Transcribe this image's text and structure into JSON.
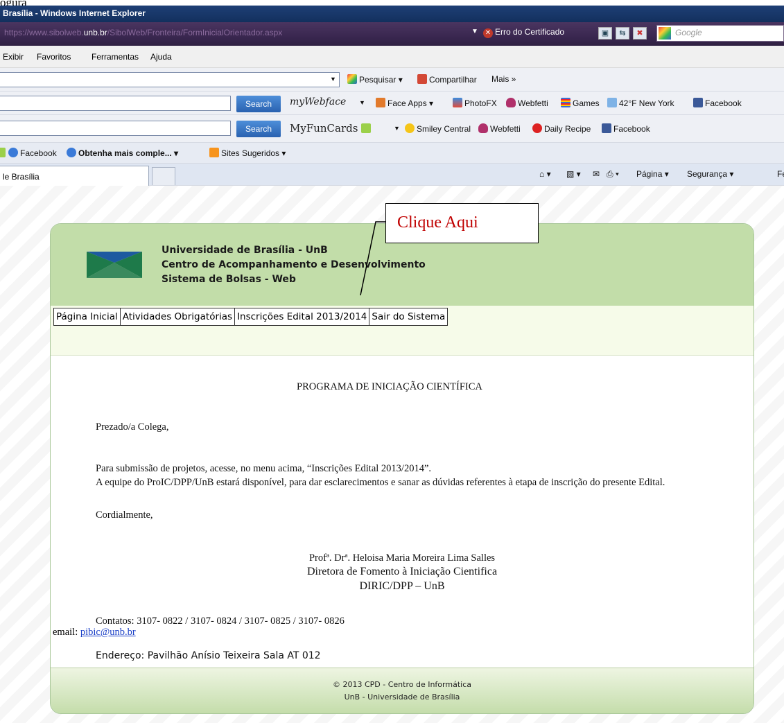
{
  "doc_text": "ogura",
  "window": {
    "title": "Brasília - Windows Internet Explorer",
    "url_prefix": "https://www.sibolweb.",
    "url_host": "unb.br",
    "url_path": "/SibolWeb/Fronteira/FormInicialOrientador.aspx",
    "cert_error": "Erro do Certificado",
    "search_placeholder": "Google"
  },
  "menu": [
    "Exibir",
    "Favoritos",
    "Ferramentas",
    "Ajuda"
  ],
  "toolbar1": {
    "search": "Pesquisar",
    "share": "Compartilhar",
    "more": "Mais »"
  },
  "toolbar2": {
    "search_button": "Search",
    "brand": "myWebface",
    "items": [
      "Face Apps",
      "PhotoFX",
      "Webfetti",
      "Games",
      "42°F New York",
      "Facebook"
    ]
  },
  "toolbar3": {
    "search_button": "Search",
    "brand": "MyFunCards",
    "items": [
      "Smiley Central",
      "Webfetti",
      "Daily Recipe",
      "Facebook"
    ]
  },
  "favorites": {
    "items": [
      "Facebook",
      "Obtenha mais comple...",
      "Sites Sugeridos"
    ]
  },
  "tabs": {
    "active": "le Brasília",
    "commands": [
      "Página",
      "Segurança",
      "Fe"
    ]
  },
  "page": {
    "header_lines": [
      "Universidade de Brasília - UnB",
      "Centro de Acompanhamento e Desenvolvimento",
      "Sistema de Bolsas - Web"
    ],
    "nav": [
      "Página Inicial",
      "Atividades Obrigatórias",
      "Inscrições Edital 2013/2014",
      "Sair do Sistema"
    ],
    "title": "PROGRAMA DE INICIAÇÃO CIENTÍFICA",
    "greeting": "Prezado/a Colega,",
    "p1": "Para submissão de projetos, acesse, no menu acima, “Inscrições Edital 2013/2014”.",
    "p2": "A equipe do ProIC/DPP/UnB estará disponível, para dar esclarecimentos e sanar as dúvidas referentes à etapa de inscrição do presente Edital.",
    "closing": "Cordialmente,",
    "signature": [
      "Profª. Drª. Heloisa Maria Moreira Lima Salles",
      "Diretora de Fomento à Iniciação Cientifica",
      "DIRIC/DPP – UnB"
    ],
    "contacts": "Contatos: 3107- 0822 / 3107- 0824 / 3107- 0825 / 3107- 0826",
    "email_label": "email:",
    "email": "pibic@unb.br",
    "address": "Endereço: Pavilhão Anísio Teixeira Sala AT 012",
    "footer": [
      "© 2013 CPD - Centro de Informática",
      "UnB - Universidade de Brasília"
    ]
  },
  "annotation": {
    "text": "Clique Aqui"
  },
  "colors": {
    "banner": "#c2dda9",
    "nav_row": "#f6fbe9",
    "callout_text": "#c00000",
    "title_bar": "#1e3f75"
  }
}
